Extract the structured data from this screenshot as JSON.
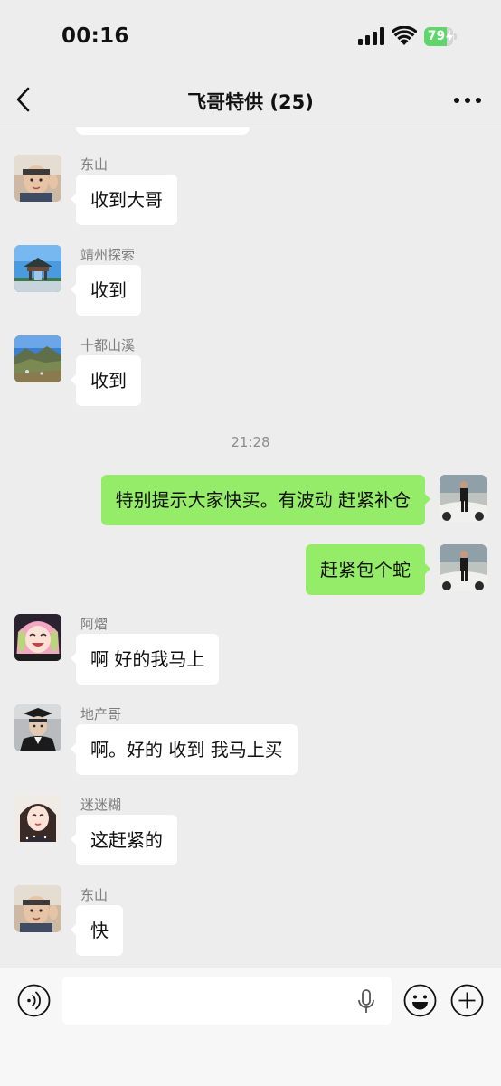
{
  "status_bar": {
    "time": "00:16",
    "battery_level": "79",
    "battery_fraction": 0.79
  },
  "nav": {
    "title": "飞哥特供 (25)",
    "back_icon": "chevron-left-icon",
    "more_icon": "more-dots-icon"
  },
  "colors": {
    "background": "#ededed",
    "incoming_bubble": "#ffffff",
    "outgoing_bubble": "#95ec69",
    "battery_green": "#5fd66a"
  },
  "messages": [
    {
      "type": "incoming",
      "sender": "东山",
      "text": "收到大哥"
    },
    {
      "type": "incoming",
      "sender": "靖州探索",
      "text": "收到"
    },
    {
      "type": "incoming",
      "sender": "十都山溪",
      "text": "收到"
    },
    {
      "type": "timestamp",
      "text": "21:28"
    },
    {
      "type": "outgoing",
      "text": "特别提示大家快买。有波动 赶紧补仓"
    },
    {
      "type": "outgoing",
      "text": "赶紧包个蛇"
    },
    {
      "type": "incoming",
      "sender": "阿熠",
      "text": "啊 好的我马上"
    },
    {
      "type": "incoming",
      "sender": "地产哥",
      "text": "啊。好的 收到 我马上买"
    },
    {
      "type": "incoming",
      "sender": "迷迷糊",
      "text": "这赶紧的"
    },
    {
      "type": "incoming",
      "sender": "东山",
      "text": "快"
    }
  ],
  "input_bar": {
    "placeholder": "",
    "voice_icon": "voice-wave-icon",
    "mic_icon": "microphone-icon",
    "emoji_icon": "smiley-icon",
    "plus_icon": "plus-icon"
  }
}
